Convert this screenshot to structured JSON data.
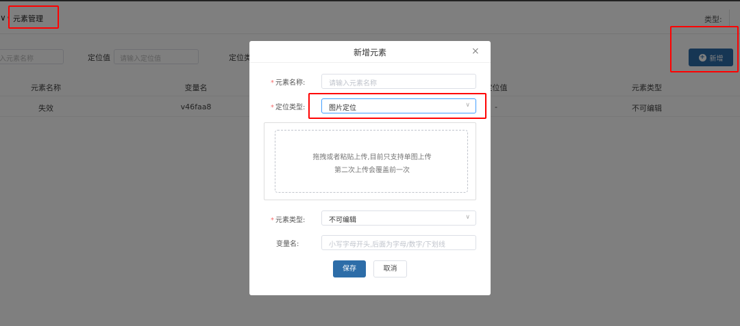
{
  "header": {
    "chevron": "∨",
    "breadcrumb": "元素管理",
    "type_label": "类型:"
  },
  "filters": {
    "name_placeholder": "入元素名称",
    "locator_label": "定位值",
    "locator_placeholder": "请输入定位值",
    "locator_type_label": "定位类",
    "add_label": "新增"
  },
  "table": {
    "columns": [
      "元素名称",
      "变量名",
      "定位值",
      "元素类型"
    ],
    "rows": [
      [
        "失效",
        "v46faa8",
        "-",
        "不可编辑"
      ]
    ]
  },
  "dialog": {
    "title": "新增元素",
    "close": "×",
    "name_label": "元素名称:",
    "name_placeholder": "请输入元素名称",
    "locator_type_label": "定位类型:",
    "locator_type_value": "图片定位",
    "upload_line1": "拖拽或者粘贴上传,目前只支持单图上传",
    "upload_line2": "第二次上传会覆盖前一次",
    "element_type_label": "元素类型:",
    "element_type_value": "不可编辑",
    "var_label": "变量名:",
    "var_placeholder": "小写字母开头,后面为字母/数字/下划线",
    "save_label": "保存",
    "cancel_label": "取消",
    "required_mark": "*"
  },
  "colors": {
    "primary": "#2d6da8",
    "highlight": "#ff0000",
    "required": "#f56c6c",
    "overlay": "rgba(0,0,0,0.5)"
  }
}
